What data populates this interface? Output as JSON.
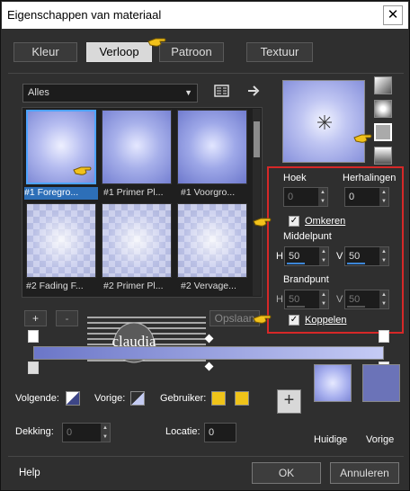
{
  "window": {
    "title": "Eigenschappen van materiaal",
    "close_label": "✕"
  },
  "tabs": [
    "Kleur",
    "Verloop",
    "Patroon",
    "Textuur"
  ],
  "active_tab": "Verloop",
  "library": {
    "dropdown_value": "Alles",
    "swatches": [
      {
        "label": "#1 Foregro..."
      },
      {
        "label": "#1 Primer Pl..."
      },
      {
        "label": "#1 Voorgro..."
      },
      {
        "label": "#2 Fading F..."
      },
      {
        "label": "#2 Primer Pl..."
      },
      {
        "label": "#2 Vervage..."
      }
    ]
  },
  "swatch_buttons": {
    "add": "+",
    "remove": "-",
    "save": "Opslaan"
  },
  "properties": {
    "hoek_label": "Hoek",
    "hoek_value": "0",
    "herhalingen_label": "Herhalingen",
    "herhalingen_value": "0",
    "omkeren_label": "Omkeren",
    "omkeren_checked": true,
    "middelpunt_label": "Middelpunt",
    "middelpunt_h_label": "H",
    "middelpunt_h": "50",
    "middelpunt_v_label": "V",
    "middelpunt_v": "50",
    "brandpunt_label": "Brandpunt",
    "brandpunt_h_label": "H",
    "brandpunt_h": "50",
    "brandpunt_v_label": "V",
    "brandpunt_v": "50",
    "koppelen_label": "Koppelen",
    "koppelen_checked": true
  },
  "stops": {
    "volgende_label": "Volgende:",
    "vorige_label": "Vorige:",
    "gebruiker_label": "Gebruiker:",
    "dekking_label": "Dekking:",
    "dekking_value": "0",
    "locatie_label": "Locatie:",
    "locatie_value": "0",
    "user_color": "#f0c419"
  },
  "colors": {
    "huidige_label": "Huidige",
    "huidige": "#aab2ef",
    "vorige_label": "Vorige",
    "vorige": "#6b73b8",
    "add_label": "+"
  },
  "watermark": {
    "text": "claudia"
  },
  "footer": {
    "help": "Help",
    "ok": "OK",
    "cancel": "Annuleren"
  }
}
